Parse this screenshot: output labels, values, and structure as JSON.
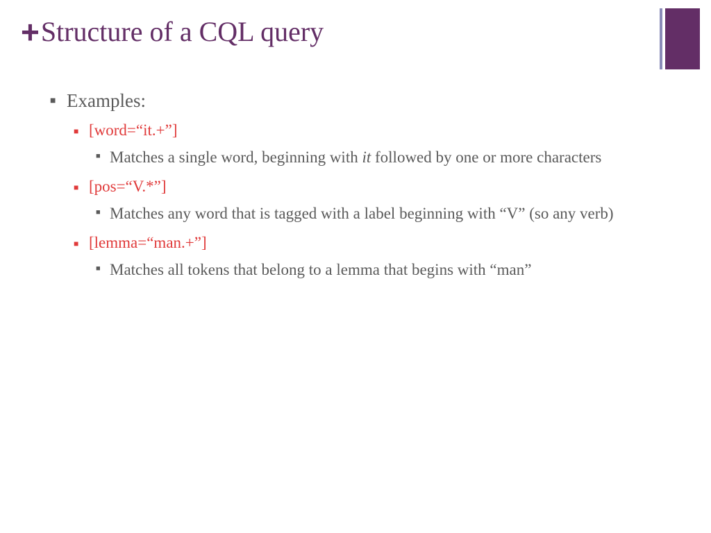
{
  "title": "Structure of a CQL query",
  "plus": "+",
  "content": {
    "L1": "Examples:",
    "items": [
      {
        "code": "[word=“it.+”]",
        "desc_pre": "Matches a single word, beginning with ",
        "desc_em": "it",
        "desc_post": " followed by one or more characters"
      },
      {
        "code": "[pos=“V.*”]",
        "desc": "Matches any word that is tagged with a label beginning with “V” (so any verb)"
      },
      {
        "code": "[lemma=“man.+”]",
        "desc": "Matches all tokens that belong to a lemma that begins with “man”"
      }
    ]
  }
}
